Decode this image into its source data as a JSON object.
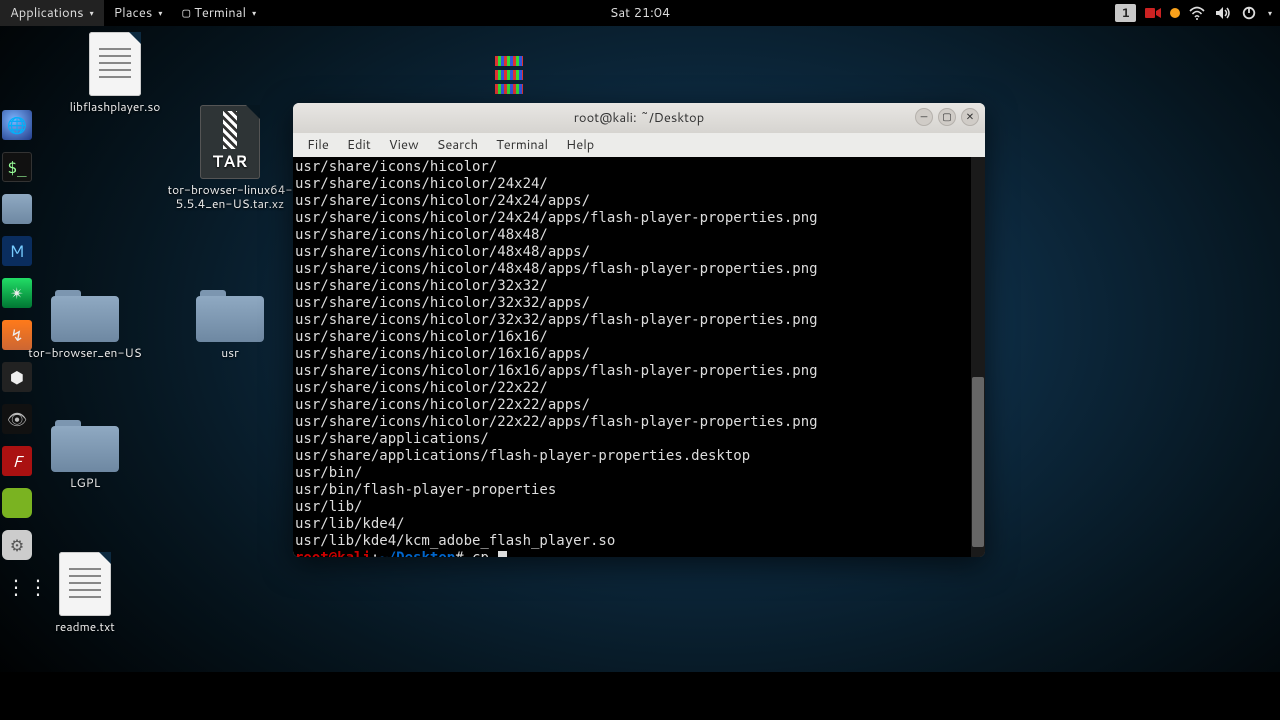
{
  "panel": {
    "apps_label": "Applications",
    "places_label": "Places",
    "term_label": "Terminal",
    "clock": "Sat 21:04",
    "workspace": "1"
  },
  "desktop_icons": {
    "libflash": "libflashplayer.so",
    "tor_archive": "tor-browser-linux64-5.5.4_en-US.tar.xz",
    "tar_badge": "TAR",
    "tor_folder": "tor-browser_en-US",
    "usr_folder": "usr",
    "lgpl_folder": "LGPL",
    "readme": "readme.txt"
  },
  "terminal": {
    "title": "root@kali: ~/Desktop",
    "menu": {
      "file": "File",
      "edit": "Edit",
      "view": "View",
      "search": "Search",
      "terminal": "Terminal",
      "help": "Help"
    },
    "output": [
      "usr/share/icons/hicolor/",
      "usr/share/icons/hicolor/24x24/",
      "usr/share/icons/hicolor/24x24/apps/",
      "usr/share/icons/hicolor/24x24/apps/flash-player-properties.png",
      "usr/share/icons/hicolor/48x48/",
      "usr/share/icons/hicolor/48x48/apps/",
      "usr/share/icons/hicolor/48x48/apps/flash-player-properties.png",
      "usr/share/icons/hicolor/32x32/",
      "usr/share/icons/hicolor/32x32/apps/",
      "usr/share/icons/hicolor/32x32/apps/flash-player-properties.png",
      "usr/share/icons/hicolor/16x16/",
      "usr/share/icons/hicolor/16x16/apps/",
      "usr/share/icons/hicolor/16x16/apps/flash-player-properties.png",
      "usr/share/icons/hicolor/22x22/",
      "usr/share/icons/hicolor/22x22/apps/",
      "usr/share/icons/hicolor/22x22/apps/flash-player-properties.png",
      "usr/share/applications/",
      "usr/share/applications/flash-player-properties.desktop",
      "usr/bin/",
      "usr/bin/flash-player-properties",
      "usr/lib/",
      "usr/lib/kde4/",
      "usr/lib/kde4/kcm_adobe_flash_player.so"
    ],
    "prompt": {
      "user": "root",
      "at": "@",
      "host": "kali",
      "colon": ":",
      "path": "~/Desktop",
      "hash": "#",
      "cmd": "cp "
    }
  },
  "dock_items": [
    "iceweasel-icon",
    "terminal-icon",
    "files-icon",
    "metasploit-icon",
    "armitage-icon",
    "burp-icon",
    "maltego-icon",
    "zenmap-icon",
    "wireshark-icon",
    "leafpad-icon",
    "tweak-icon",
    "apps-grid-icon"
  ]
}
